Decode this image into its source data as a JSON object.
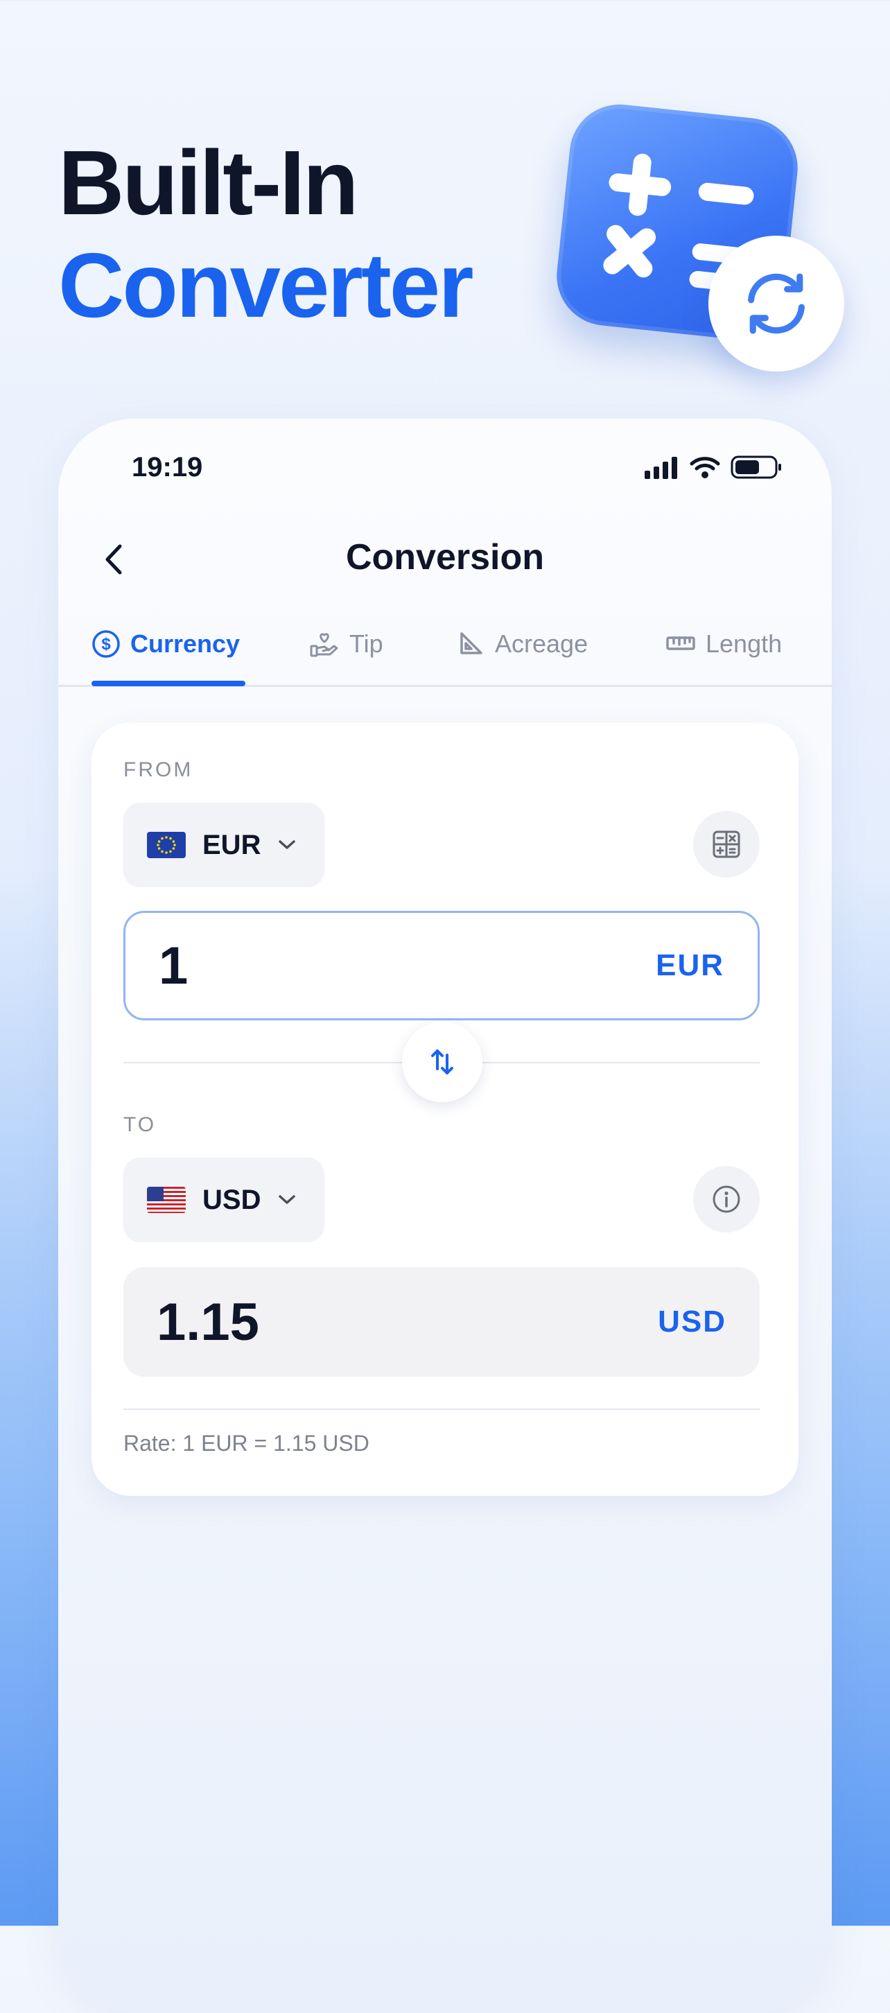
{
  "hero": {
    "line1": "Built-In",
    "line2": "Converter"
  },
  "status_bar": {
    "time": "19:19"
  },
  "nav": {
    "title": "Conversion"
  },
  "tabs": [
    {
      "label": "Currency",
      "icon": "dollar-circle-icon",
      "active": true
    },
    {
      "label": "Tip",
      "icon": "hand-heart-icon",
      "active": false
    },
    {
      "label": "Acreage",
      "icon": "set-square-icon",
      "active": false
    },
    {
      "label": "Length",
      "icon": "ruler-icon",
      "active": false
    }
  ],
  "from": {
    "label": "FROM",
    "currency": "EUR",
    "amount": "1",
    "unit": "EUR"
  },
  "to": {
    "label": "TO",
    "currency": "USD",
    "amount": "1.15",
    "unit": "USD"
  },
  "rate_text": "Rate: 1 EUR = 1.15 USD",
  "colors": {
    "accent": "#1a63ee",
    "title": "#0f1629",
    "muted": "#8c92a0",
    "input_border": "#93b4f2"
  }
}
